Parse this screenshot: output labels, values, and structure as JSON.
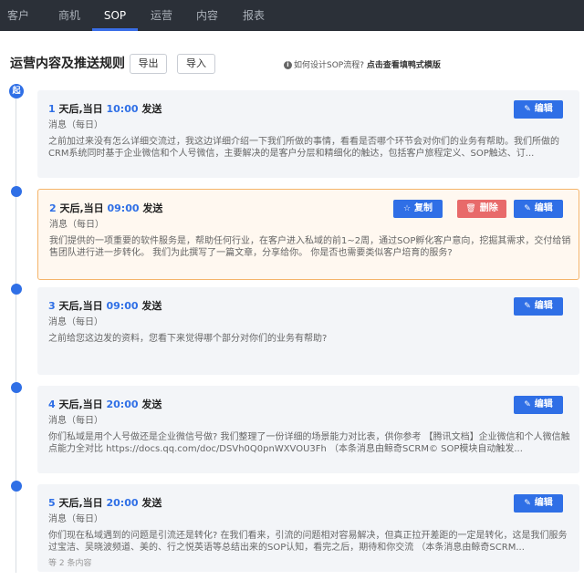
{
  "nav": {
    "tabs": [
      {
        "label": "客户"
      },
      {
        "label": "商机"
      },
      {
        "label": "SOP"
      },
      {
        "label": "运营"
      },
      {
        "label": "内容"
      },
      {
        "label": "报表"
      }
    ],
    "active_tab": "SOP"
  },
  "header": {
    "title": "运营内容及推送规则",
    "export_label": "导出",
    "import_label": "导入",
    "help_prefix": "如何设计SOP流程?",
    "help_link": "点击查看填鸭式模版"
  },
  "timeline": {
    "start_label": "起"
  },
  "actions": {
    "edit": "编辑",
    "copy": "复制",
    "delete": "删除"
  },
  "cards": [
    {
      "day": "1",
      "day_suffix": " 天后,当日 ",
      "time": "10:00",
      "send": " 发送",
      "type": "消息（每日）",
      "body": "之前加过来没有怎么详细交流过，我这边详细介绍一下我们所做的事情，看看是否哪个环节会对你们的业务有帮助。我们所做的CRM系统同时基于企业微信和个人号微信，主要解决的是客户分层和精细化的触达，包括客户旅程定义、SOP触达、订..."
    },
    {
      "day": "2",
      "day_suffix": " 天后,当日 ",
      "time": "09:00",
      "send": " 发送",
      "type": "消息（每日）",
      "body": "我们提供的一项重要的软件服务是，帮助任何行业，在客户进入私域的前1~2周，通过SOP孵化客户意向，挖掘其需求，交付给销售团队进行进一步转化。 我们为此撰写了一篇文章，分享给你。 你是否也需要类似客户培育的服务?"
    },
    {
      "day": "3",
      "day_suffix": " 天后,当日 ",
      "time": "09:00",
      "send": " 发送",
      "type": "消息（每日）",
      "body": "之前给您这边发的资料，您看下来觉得哪个部分对你们的业务有帮助?"
    },
    {
      "day": "4",
      "day_suffix": " 天后,当日 ",
      "time": "20:00",
      "send": " 发送",
      "type": "消息（每日）",
      "body": "你们私域是用个人号做还是企业微信号做? 我们整理了一份详细的场景能力对比表，供你参考 【腾讯文档】企业微信和个人微信触点能力全对比 https://docs.qq.com/doc/DSVh0Q0pnWXVOU3Fh （本条消息由鲸奇SCRM© SOP模块自动触发..."
    },
    {
      "day": "5",
      "day_suffix": " 天后,当日 ",
      "time": "20:00",
      "send": " 发送",
      "type": "消息（每日）",
      "body": "你们现在私域遇到的问题是引流还是转化? 在我们看来，引流的问题相对容易解决，但真正拉开差距的一定是转化，这是我们服务过宝洁、吴晓波频道、美的、行之悦英语等总结出来的SOP认知，看完之后，期待和你交流 （本条消息由鲸奇SCRM...",
      "more": "等 2 条内容"
    }
  ],
  "colors": {
    "accent": "#2f6fe6",
    "danger": "#e86a6a",
    "highlight_border": "#f5b46a",
    "nav_bg": "#2b3038"
  }
}
